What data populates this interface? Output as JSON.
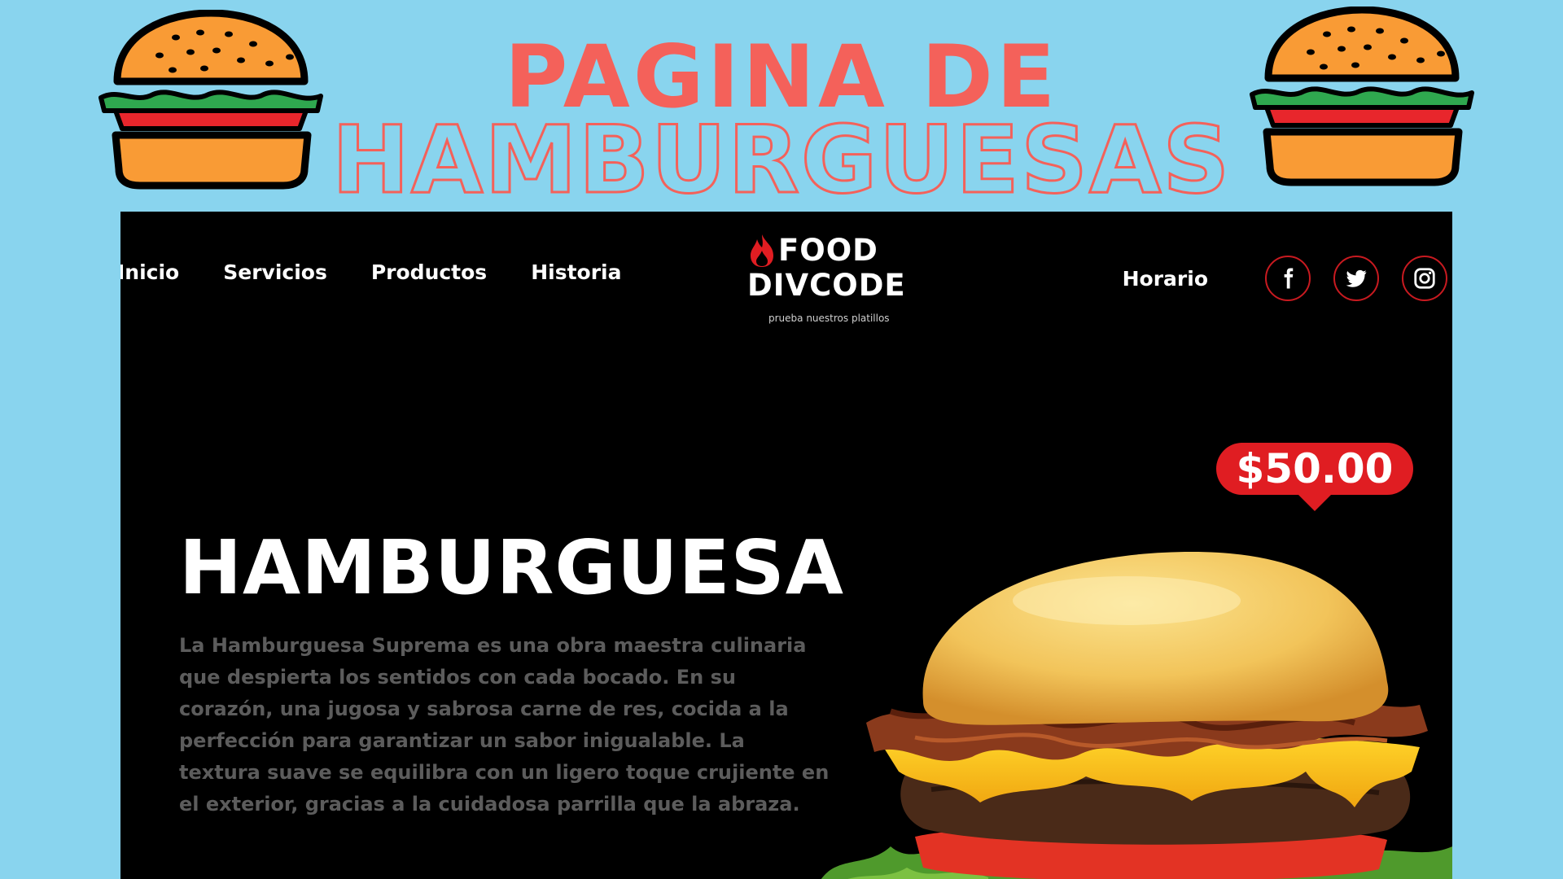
{
  "banner": {
    "title_line1": "PAGINA DE",
    "title_line2": "HAMBURGUESAS",
    "icons": [
      "burger-icon",
      "burger-icon"
    ]
  },
  "nav": {
    "items": [
      {
        "label": "Inicio"
      },
      {
        "label": "Servicios"
      },
      {
        "label": "Productos"
      },
      {
        "label": "Historia"
      }
    ],
    "right": {
      "label": "Horario"
    },
    "social": [
      "facebook-icon",
      "twitter-icon",
      "instagram-icon"
    ]
  },
  "logo": {
    "line1": "FOOD",
    "line2": "DIVCODE",
    "tagline": "prueba nuestros platillos"
  },
  "hero": {
    "heading": "HAMBURGUESA",
    "description": "La Hamburguesa Suprema es una obra maestra culinaria que despierta los sentidos con cada bocado. En su corazón, una jugosa y sabrosa carne de res, cocida a la perfección para garantizar un sabor inigualable. La textura suave se equilibra con un ligero toque crujiente en el exterior, gracias a la cuidadosa parrilla que la abraza.",
    "price": "$50.00"
  },
  "colors": {
    "background": "#89d4ee",
    "title": "#f4615a",
    "site_bg": "#000000",
    "accent": "#e01d22",
    "description": "#5c5c5c"
  }
}
